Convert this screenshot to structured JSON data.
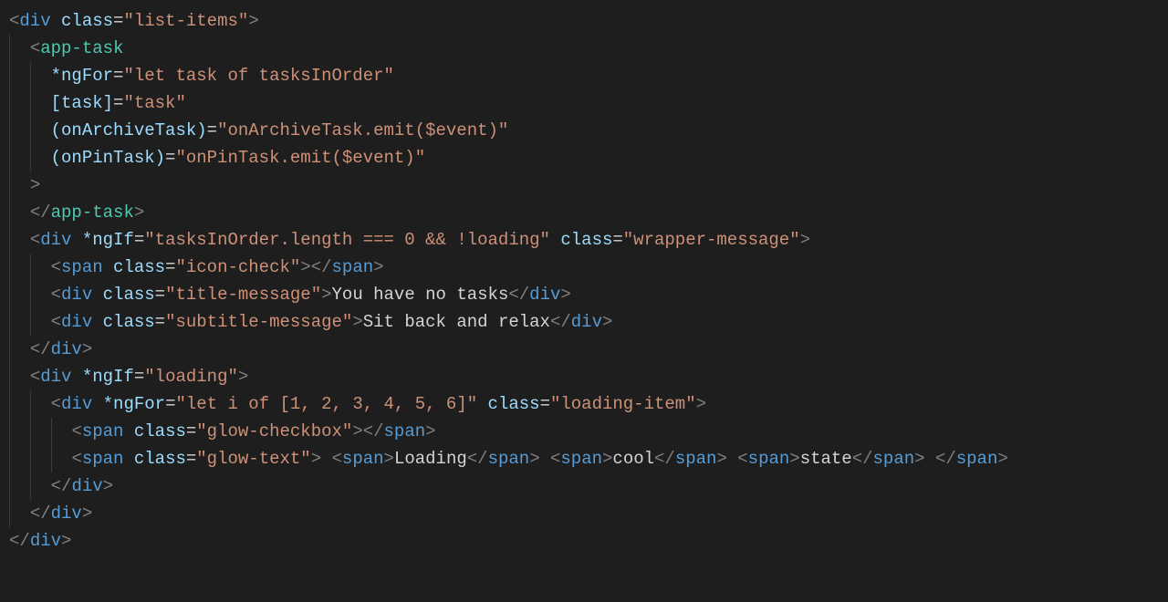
{
  "code": {
    "lines": [
      {
        "indent": 0,
        "segments": [
          {
            "t": "<",
            "c": "br"
          },
          {
            "t": "div",
            "c": "tag"
          },
          {
            "t": " ",
            "c": "txt"
          },
          {
            "t": "class",
            "c": "attr"
          },
          {
            "t": "=",
            "c": "eq"
          },
          {
            "t": "\"list-items\"",
            "c": "str"
          },
          {
            "t": ">",
            "c": "br"
          }
        ]
      },
      {
        "indent": 1,
        "segments": [
          {
            "t": "<",
            "c": "br"
          },
          {
            "t": "app-task",
            "c": "comp"
          }
        ]
      },
      {
        "indent": 2,
        "segments": [
          {
            "t": "*ngFor",
            "c": "attr"
          },
          {
            "t": "=",
            "c": "eq"
          },
          {
            "t": "\"let task of tasksInOrder\"",
            "c": "str"
          }
        ]
      },
      {
        "indent": 2,
        "segments": [
          {
            "t": "[task]",
            "c": "attr"
          },
          {
            "t": "=",
            "c": "eq"
          },
          {
            "t": "\"task\"",
            "c": "str"
          }
        ]
      },
      {
        "indent": 2,
        "segments": [
          {
            "t": "(onArchiveTask)",
            "c": "attr"
          },
          {
            "t": "=",
            "c": "eq"
          },
          {
            "t": "\"onArchiveTask.emit($event)\"",
            "c": "str"
          }
        ]
      },
      {
        "indent": 2,
        "segments": [
          {
            "t": "(onPinTask)",
            "c": "attr"
          },
          {
            "t": "=",
            "c": "eq"
          },
          {
            "t": "\"onPinTask.emit($event)\"",
            "c": "str"
          }
        ]
      },
      {
        "indent": 1,
        "segments": [
          {
            "t": ">",
            "c": "br"
          }
        ]
      },
      {
        "indent": 1,
        "segments": [
          {
            "t": "</",
            "c": "br"
          },
          {
            "t": "app-task",
            "c": "comp"
          },
          {
            "t": ">",
            "c": "br"
          }
        ]
      },
      {
        "indent": 1,
        "segments": [
          {
            "t": "<",
            "c": "br"
          },
          {
            "t": "div",
            "c": "tag"
          },
          {
            "t": " ",
            "c": "txt"
          },
          {
            "t": "*ngIf",
            "c": "attr"
          },
          {
            "t": "=",
            "c": "eq"
          },
          {
            "t": "\"tasksInOrder.length === 0 && !loading\"",
            "c": "str"
          },
          {
            "t": " ",
            "c": "txt"
          },
          {
            "t": "class",
            "c": "attr"
          },
          {
            "t": "=",
            "c": "eq"
          },
          {
            "t": "\"wrapper-message\"",
            "c": "str"
          },
          {
            "t": ">",
            "c": "br"
          }
        ]
      },
      {
        "indent": 2,
        "segments": [
          {
            "t": "<",
            "c": "br"
          },
          {
            "t": "span",
            "c": "tag"
          },
          {
            "t": " ",
            "c": "txt"
          },
          {
            "t": "class",
            "c": "attr"
          },
          {
            "t": "=",
            "c": "eq"
          },
          {
            "t": "\"icon-check\"",
            "c": "str"
          },
          {
            "t": "></",
            "c": "br"
          },
          {
            "t": "span",
            "c": "tag"
          },
          {
            "t": ">",
            "c": "br"
          }
        ]
      },
      {
        "indent": 2,
        "segments": [
          {
            "t": "<",
            "c": "br"
          },
          {
            "t": "div",
            "c": "tag"
          },
          {
            "t": " ",
            "c": "txt"
          },
          {
            "t": "class",
            "c": "attr"
          },
          {
            "t": "=",
            "c": "eq"
          },
          {
            "t": "\"title-message\"",
            "c": "str"
          },
          {
            "t": ">",
            "c": "br"
          },
          {
            "t": "You have no tasks",
            "c": "txt"
          },
          {
            "t": "</",
            "c": "br"
          },
          {
            "t": "div",
            "c": "tag"
          },
          {
            "t": ">",
            "c": "br"
          }
        ]
      },
      {
        "indent": 2,
        "segments": [
          {
            "t": "<",
            "c": "br"
          },
          {
            "t": "div",
            "c": "tag"
          },
          {
            "t": " ",
            "c": "txt"
          },
          {
            "t": "class",
            "c": "attr"
          },
          {
            "t": "=",
            "c": "eq"
          },
          {
            "t": "\"subtitle-message\"",
            "c": "str"
          },
          {
            "t": ">",
            "c": "br"
          },
          {
            "t": "Sit back and relax",
            "c": "txt"
          },
          {
            "t": "</",
            "c": "br"
          },
          {
            "t": "div",
            "c": "tag"
          },
          {
            "t": ">",
            "c": "br"
          }
        ]
      },
      {
        "indent": 1,
        "segments": [
          {
            "t": "</",
            "c": "br"
          },
          {
            "t": "div",
            "c": "tag"
          },
          {
            "t": ">",
            "c": "br"
          }
        ]
      },
      {
        "indent": 1,
        "segments": [
          {
            "t": "<",
            "c": "br"
          },
          {
            "t": "div",
            "c": "tag"
          },
          {
            "t": " ",
            "c": "txt"
          },
          {
            "t": "*ngIf",
            "c": "attr"
          },
          {
            "t": "=",
            "c": "eq"
          },
          {
            "t": "\"loading\"",
            "c": "str"
          },
          {
            "t": ">",
            "c": "br"
          }
        ]
      },
      {
        "indent": 2,
        "segments": [
          {
            "t": "<",
            "c": "br"
          },
          {
            "t": "div",
            "c": "tag"
          },
          {
            "t": " ",
            "c": "txt"
          },
          {
            "t": "*ngFor",
            "c": "attr"
          },
          {
            "t": "=",
            "c": "eq"
          },
          {
            "t": "\"let i of [1, 2, 3, 4, 5, 6]\"",
            "c": "str"
          },
          {
            "t": " ",
            "c": "txt"
          },
          {
            "t": "class",
            "c": "attr"
          },
          {
            "t": "=",
            "c": "eq"
          },
          {
            "t": "\"loading-item\"",
            "c": "str"
          },
          {
            "t": ">",
            "c": "br"
          }
        ]
      },
      {
        "indent": 3,
        "segments": [
          {
            "t": "<",
            "c": "br"
          },
          {
            "t": "span",
            "c": "tag"
          },
          {
            "t": " ",
            "c": "txt"
          },
          {
            "t": "class",
            "c": "attr"
          },
          {
            "t": "=",
            "c": "eq"
          },
          {
            "t": "\"glow-checkbox\"",
            "c": "str"
          },
          {
            "t": "></",
            "c": "br"
          },
          {
            "t": "span",
            "c": "tag"
          },
          {
            "t": ">",
            "c": "br"
          }
        ]
      },
      {
        "indent": 3,
        "segments": [
          {
            "t": "<",
            "c": "br"
          },
          {
            "t": "span",
            "c": "tag"
          },
          {
            "t": " ",
            "c": "txt"
          },
          {
            "t": "class",
            "c": "attr"
          },
          {
            "t": "=",
            "c": "eq"
          },
          {
            "t": "\"glow-text\"",
            "c": "str"
          },
          {
            "t": ">",
            "c": "br"
          },
          {
            "t": " ",
            "c": "txt"
          },
          {
            "t": "<",
            "c": "br"
          },
          {
            "t": "span",
            "c": "tag"
          },
          {
            "t": ">",
            "c": "br"
          },
          {
            "t": "Loading",
            "c": "txt"
          },
          {
            "t": "</",
            "c": "br"
          },
          {
            "t": "span",
            "c": "tag"
          },
          {
            "t": ">",
            "c": "br"
          },
          {
            "t": " ",
            "c": "txt"
          },
          {
            "t": "<",
            "c": "br"
          },
          {
            "t": "span",
            "c": "tag"
          },
          {
            "t": ">",
            "c": "br"
          },
          {
            "t": "cool",
            "c": "txt"
          },
          {
            "t": "</",
            "c": "br"
          },
          {
            "t": "span",
            "c": "tag"
          },
          {
            "t": ">",
            "c": "br"
          },
          {
            "t": " ",
            "c": "txt"
          },
          {
            "t": "<",
            "c": "br"
          },
          {
            "t": "span",
            "c": "tag"
          },
          {
            "t": ">",
            "c": "br"
          },
          {
            "t": "state",
            "c": "txt"
          },
          {
            "t": "</",
            "c": "br"
          },
          {
            "t": "span",
            "c": "tag"
          },
          {
            "t": ">",
            "c": "br"
          },
          {
            "t": " ",
            "c": "txt"
          },
          {
            "t": "</",
            "c": "br"
          },
          {
            "t": "span",
            "c": "tag"
          },
          {
            "t": ">",
            "c": "br"
          }
        ]
      },
      {
        "indent": 2,
        "segments": [
          {
            "t": "</",
            "c": "br"
          },
          {
            "t": "div",
            "c": "tag"
          },
          {
            "t": ">",
            "c": "br"
          }
        ]
      },
      {
        "indent": 1,
        "segments": [
          {
            "t": "</",
            "c": "br"
          },
          {
            "t": "div",
            "c": "tag"
          },
          {
            "t": ">",
            "c": "br"
          }
        ]
      },
      {
        "indent": 0,
        "segments": [
          {
            "t": "</",
            "c": "br"
          },
          {
            "t": "div",
            "c": "tag"
          },
          {
            "t": ">",
            "c": "br"
          }
        ]
      }
    ]
  }
}
